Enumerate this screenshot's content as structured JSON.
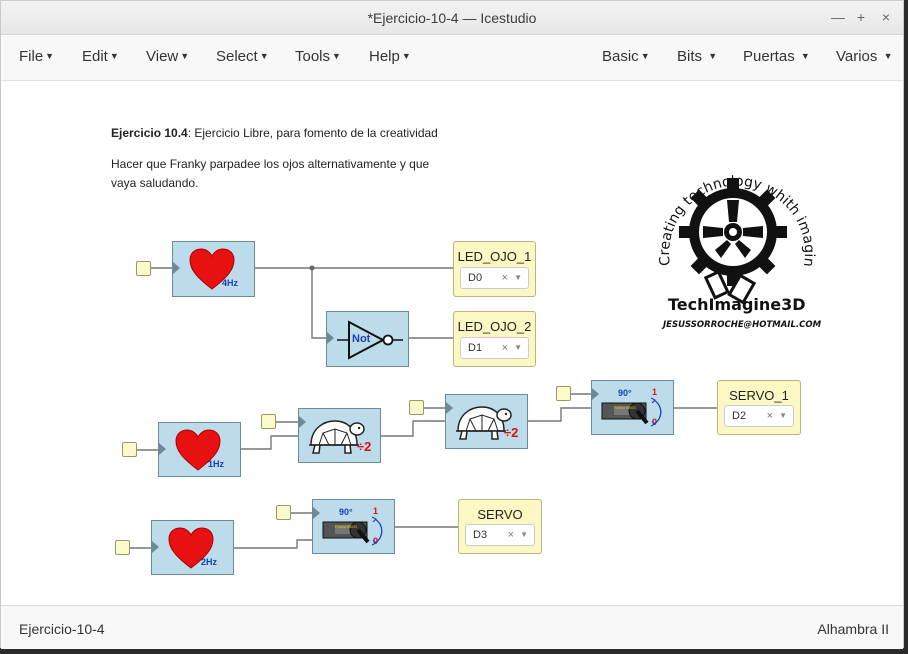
{
  "window": {
    "title": "*Ejercicio-10-4 — Icestudio",
    "controls": [
      "—",
      "+",
      "×"
    ]
  },
  "menubar": {
    "left": [
      {
        "label": "File"
      },
      {
        "label": "Edit"
      },
      {
        "label": "View"
      },
      {
        "label": "Select"
      },
      {
        "label": "Tools"
      },
      {
        "label": "Help"
      }
    ],
    "right": [
      {
        "label": "Basic"
      },
      {
        "label": "Bits"
      },
      {
        "label": "Puertas"
      },
      {
        "label": "Varios"
      }
    ]
  },
  "canvas": {
    "description": {
      "title_bold": "Ejercicio 10.4",
      "title_rest": ": Ejercicio Libre, para fomento de la creatividad",
      "body": "Hacer que Franky parpadee los ojos alternativamente y que vaya saludando."
    },
    "logo": {
      "arc_text": "Creating technology whith imagination",
      "brand": "TechImagine3D",
      "email": "JESUSSORROCHE@HOTMAIL.COM"
    },
    "blocks": {
      "heart_4hz": {
        "label": "4Hz"
      },
      "heart_1hz": {
        "label": "1Hz"
      },
      "heart_2hz": {
        "label": "2Hz"
      },
      "not_gate": {
        "label": "Not"
      },
      "prescaler_1": {
        "label": "÷2"
      },
      "prescaler_2": {
        "label": "÷2"
      },
      "servo_1": {
        "angle": "90°",
        "mark1": "1",
        "mark0": "0",
        "device": "Futaba S3003"
      },
      "servo_2": {
        "angle": "90°",
        "mark1": "1",
        "mark0": "0",
        "device": "Futaba S3003"
      }
    },
    "outputs": {
      "led_ojo_1": {
        "label": "LED_OJO_1",
        "pin": "D0"
      },
      "led_ojo_2": {
        "label": "LED_OJO_2",
        "pin": "D1"
      },
      "servo_1": {
        "label": "SERVO_1",
        "pin": "D2"
      },
      "servo": {
        "label": "SERVO",
        "pin": "D3"
      }
    },
    "select_clear": "×",
    "colors": {
      "block_bg": "#bcdceb",
      "io_bg": "#fbf8c3",
      "heart": "#e81010",
      "label_blue": "#1a3fb5",
      "label_red": "#e01010"
    }
  },
  "statusbar": {
    "project": "Ejercicio-10-4",
    "board": "Alhambra II"
  }
}
